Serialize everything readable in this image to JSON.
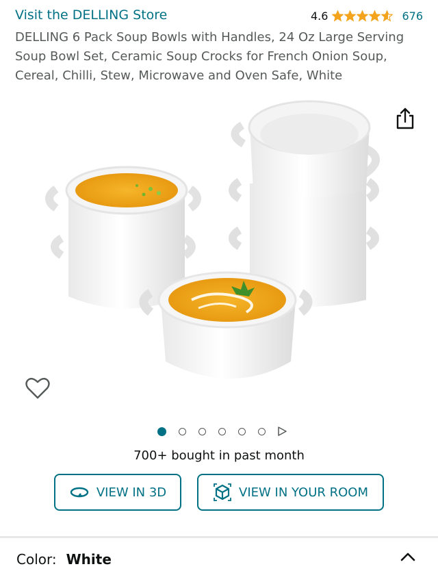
{
  "store": {
    "link_text": "Visit the DELLING Store"
  },
  "rating": {
    "value": "4.6",
    "stars": 4.6,
    "count": "676",
    "star_color": "#f4a41c"
  },
  "product": {
    "title": "DELLING 6 Pack Soup Bowls with Handles, 24 Oz Large Serving Soup Bowl Set, Ceramic Soup Crocks for French Onion Soup, Cereal, Chilli, Stew, Microwave and Oven Safe, White"
  },
  "gallery": {
    "image_count": 6,
    "active_index": 0
  },
  "social_proof": {
    "bought_text": "700+ bought in past month"
  },
  "buttons": {
    "view_3d": "VIEW IN 3D",
    "view_room": "VIEW IN YOUR ROOM"
  },
  "variation": {
    "label": "Color:",
    "value": "White"
  },
  "theme": {
    "accent": "#007185",
    "text": "#0f1111",
    "muted": "#565959"
  },
  "icons": [
    "share-icon",
    "heart-icon",
    "rotate-3d-icon",
    "ar-cube-icon",
    "chevron-up-icon",
    "play-icon"
  ]
}
